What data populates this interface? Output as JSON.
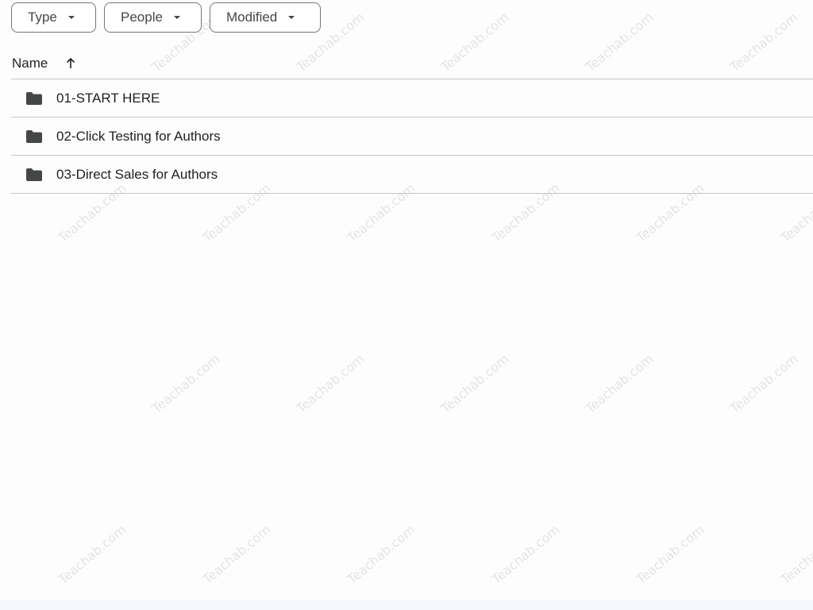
{
  "filters": {
    "type_label": "Type",
    "people_label": "People",
    "modified_label": "Modified"
  },
  "list_header": {
    "name_label": "Name",
    "sort_icon": "arrow-up-icon"
  },
  "rows": [
    {
      "label": "01-START HERE",
      "icon": "folder-icon"
    },
    {
      "label": "02-Click Testing for Authors",
      "icon": "folder-icon"
    },
    {
      "label": "03-Direct Sales for Authors",
      "icon": "folder-icon"
    }
  ],
  "watermark_text": "Teachab.com"
}
